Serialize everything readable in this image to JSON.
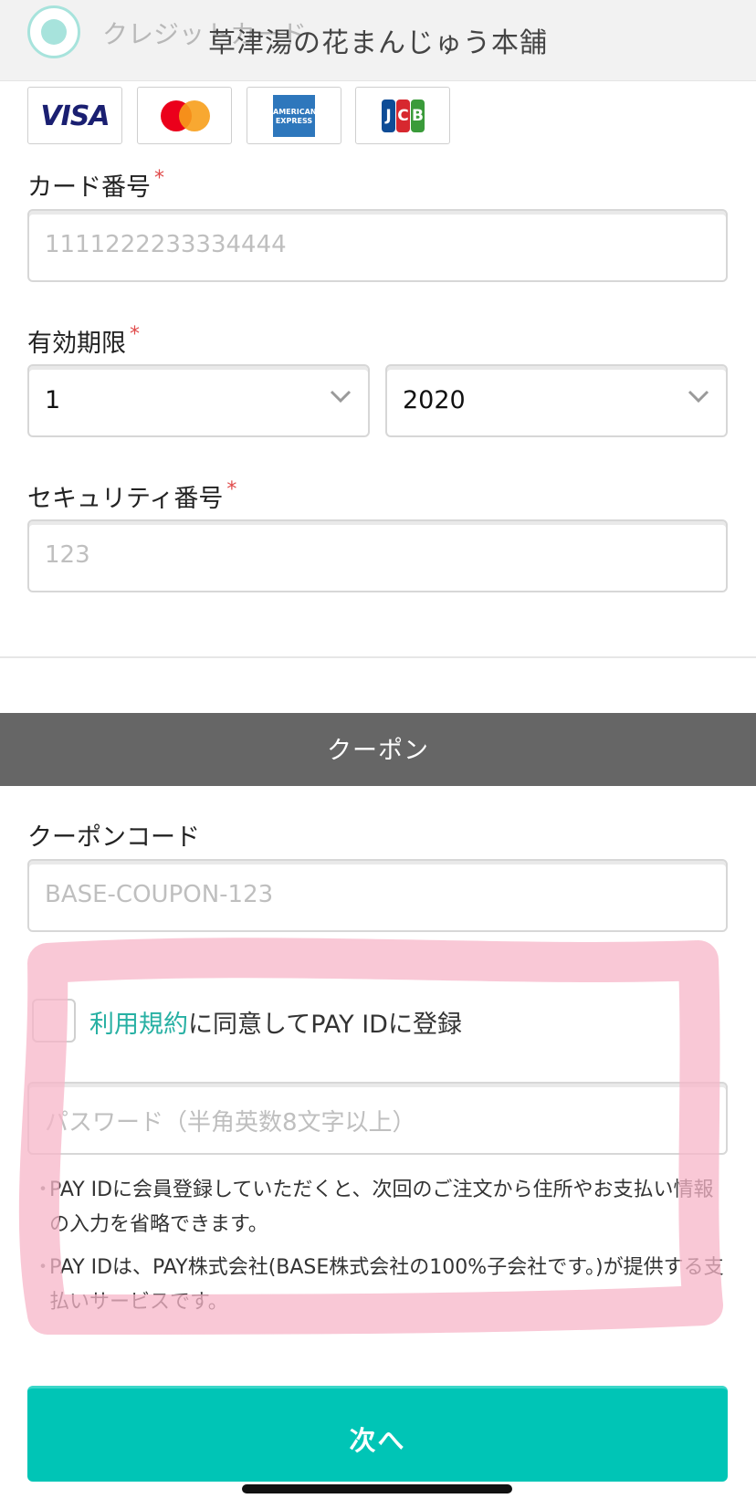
{
  "header": {
    "payment_method_label": "クレジットカード",
    "shop_title": "草津湯の花まんじゅう本舗"
  },
  "card_logos": {
    "visa": "VISA",
    "amex_line1": "AMERICAN",
    "amex_line2": "EXPRESS",
    "jcb_j": "J",
    "jcb_c": "C",
    "jcb_b": "B"
  },
  "card_form": {
    "card_number_label": "カード番号",
    "card_number_placeholder": "1111222233334444",
    "required_mark": "*",
    "expiry_label": "有効期限",
    "expiry_month": "1",
    "expiry_year": "2020",
    "security_label": "セキュリティ番号",
    "security_placeholder": "123"
  },
  "coupon": {
    "section_title": "クーポン",
    "code_label": "クーポンコード",
    "code_placeholder": "BASE-COUPON-123"
  },
  "pay_id": {
    "terms_link": "利用規約",
    "agree_text": "に同意してPAY IDに登録",
    "password_placeholder": "パスワード（半角英数8文字以上）",
    "notes": [
      "PAY IDに会員登録していただくと、次回のご注文から住所やお支払い情報の入力を省略できます。",
      "PAY IDは、PAY株式会社(BASE株式会社の100%子会社です。)が提供する支払いサービスです。"
    ],
    "bullet": "・"
  },
  "footer": {
    "next_label": "次へ"
  },
  "colors": {
    "accent": "#00c5b6",
    "link": "#27b0a3",
    "required": "#e04a4a",
    "coupon_bar": "#666666",
    "highlight": "#f7b6c8"
  },
  "icons": [
    "radio-selected-icon",
    "visa-logo-icon",
    "mastercard-logo-icon",
    "amex-logo-icon",
    "jcb-logo-icon",
    "chevron-down-icon"
  ]
}
